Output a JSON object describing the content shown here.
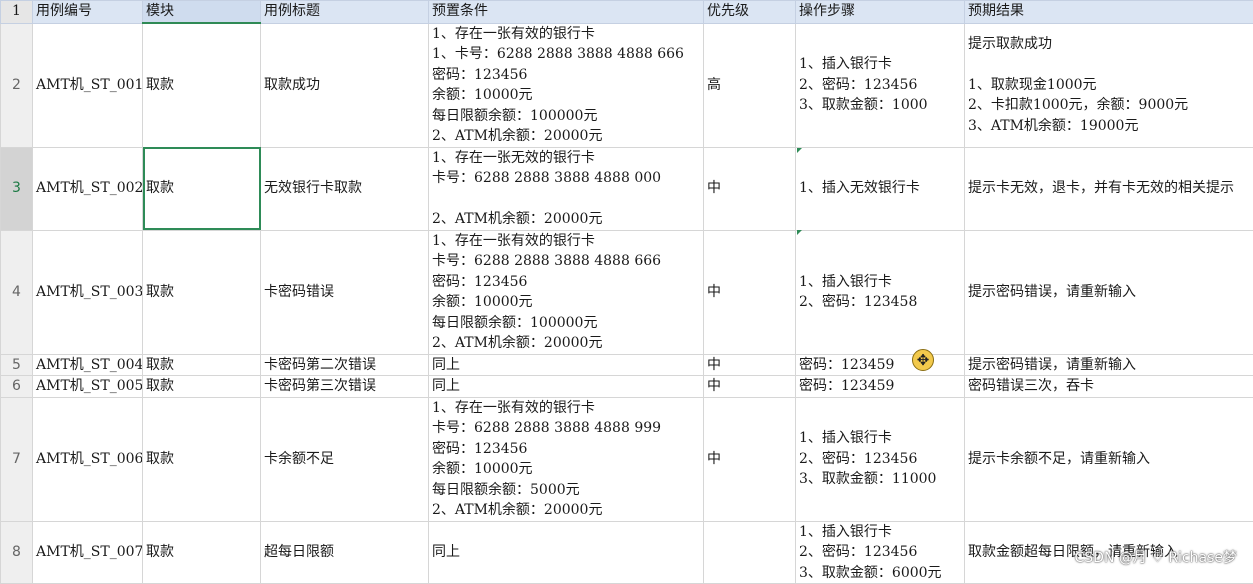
{
  "columns": [
    "用例编号",
    "模块",
    "用例标题",
    "预置条件",
    "优先级",
    "操作步骤",
    "预期结果"
  ],
  "header_row_number": "1",
  "rows": [
    {
      "num": "2",
      "id": "AMT机_ST_001",
      "module": "取款",
      "title": "取款成功",
      "pre": [
        "1、存在一张有效的银行卡",
        "1、卡号：6288 2888 3888 4888 666",
        "密码：123456",
        "余额：10000元",
        "每日限额余额：100000元",
        "2、ATM机余额：20000元"
      ],
      "priority": "高",
      "steps": [
        "1、插入银行卡",
        "2、密码：123456",
        "3、取款金额：1000"
      ],
      "expected": [
        "提示取款成功",
        "",
        "1、取款现金1000元",
        "2、卡扣款1000元，余额：9000元",
        "3、ATM机余额：19000元"
      ]
    },
    {
      "num": "3",
      "id": "AMT机_ST_002",
      "module": "取款",
      "title": "无效银行卡取款",
      "pre": [
        "1、存在一张无效的银行卡",
        "卡号：6288 2888 3888 4888 000",
        "",
        "2、ATM机余额：20000元"
      ],
      "priority": "中",
      "steps": [
        "1、插入无效银行卡"
      ],
      "expected": [
        "提示卡无效，退卡，并有卡无效的相关提示"
      ]
    },
    {
      "num": "4",
      "id": "AMT机_ST_003",
      "module": "取款",
      "title": "卡密码错误",
      "pre": [
        "1、存在一张有效的银行卡",
        "卡号：6288 2888 3888 4888 666",
        "密码：123456",
        "余额：10000元",
        "每日限额余额：100000元",
        "2、ATM机余额：20000元"
      ],
      "priority": "中",
      "steps": [
        "1、插入银行卡",
        "2、密码：123458"
      ],
      "expected": [
        "提示密码错误，请重新输入"
      ]
    },
    {
      "num": "5",
      "id": "AMT机_ST_004",
      "module": "取款",
      "title": "卡密码第二次错误",
      "pre": [
        "同上"
      ],
      "priority": "中",
      "steps": [
        "密码：123459"
      ],
      "expected": [
        "提示密码错误，请重新输入"
      ]
    },
    {
      "num": "6",
      "id": "AMT机_ST_005",
      "module": "取款",
      "title": "卡密码第三次错误",
      "pre": [
        "同上"
      ],
      "priority": "中",
      "steps": [
        "密码：123459"
      ],
      "expected": [
        "密码错误三次，吞卡"
      ]
    },
    {
      "num": "7",
      "id": "AMT机_ST_006",
      "module": "取款",
      "title": "卡余额不足",
      "pre": [
        "1、存在一张有效的银行卡",
        "卡号：6288 2888 3888 4888 999",
        "密码：123456",
        "余额：10000元",
        "每日限额余额：5000元",
        "2、ATM机余额：20000元"
      ],
      "priority": "中",
      "steps": [
        "1、插入银行卡",
        "2、密码：123456",
        "3、取款金额：11000"
      ],
      "expected": [
        "提示卡余额不足，请重新输入"
      ]
    },
    {
      "num": "8",
      "id": "AMT机_ST_007",
      "module": "取款",
      "title": "超每日限额",
      "pre": [
        "同上"
      ],
      "priority": "",
      "steps": [
        "1、插入银行卡",
        "2、密码：123456",
        "3、取款金额：6000元"
      ],
      "expected": [
        "取款金额超每日限额，请重新输入"
      ]
    }
  ],
  "selected_row_number": "3",
  "selected_cell": "module",
  "watermark": "CSDN @月 ♡ Richase梦"
}
